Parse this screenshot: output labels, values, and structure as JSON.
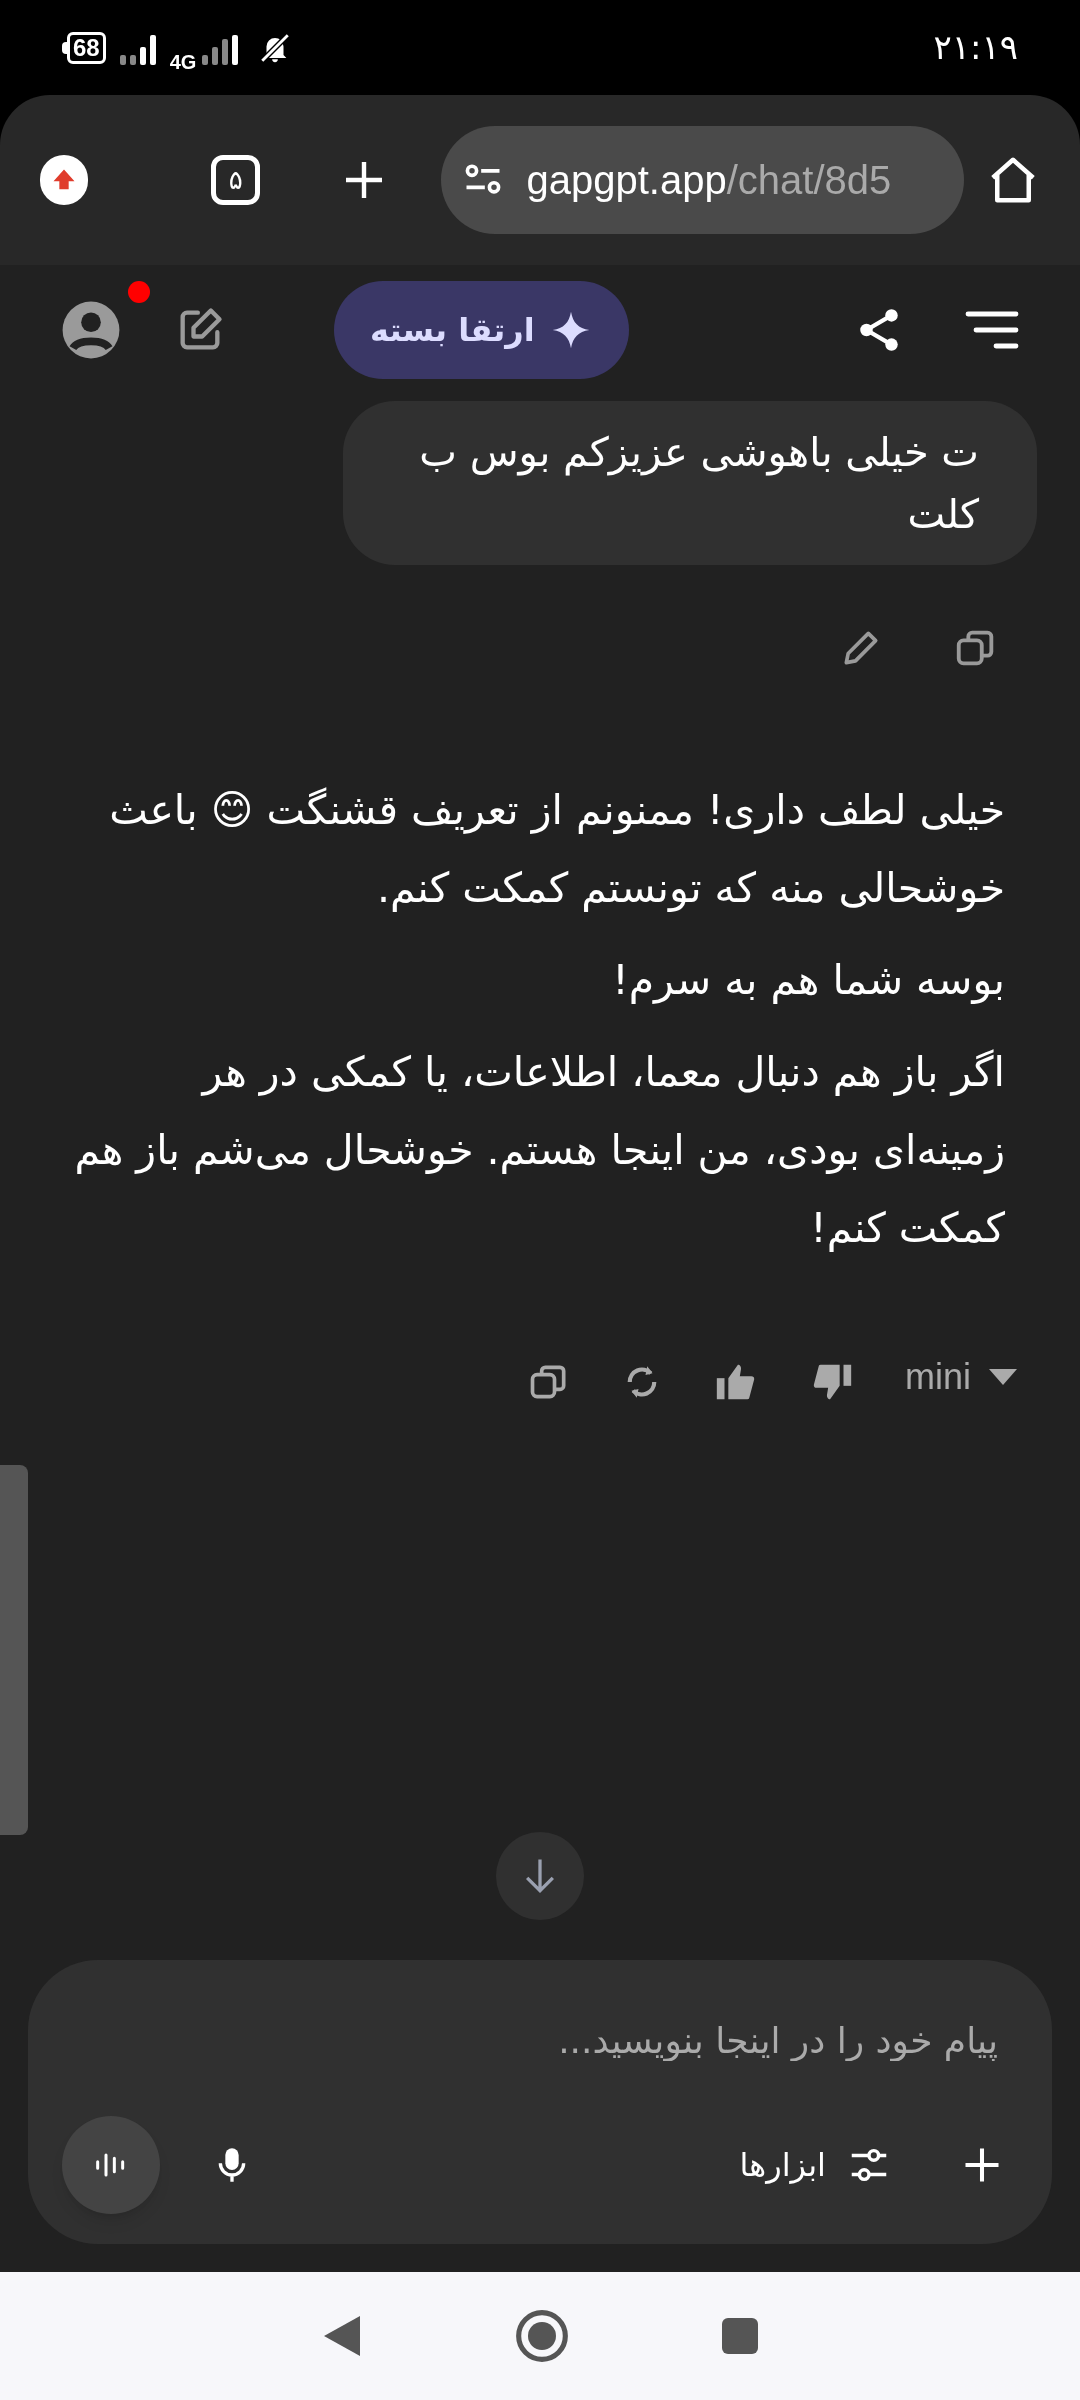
{
  "status_bar": {
    "battery": "68",
    "network": "4G",
    "time": "۲۱:۱۹"
  },
  "browser": {
    "tab_count": "۵",
    "url_host": "gapgpt.app",
    "url_path": "/chat/8d5"
  },
  "chat_header": {
    "upgrade_button": "ارتقا بسته",
    "has_notification": true
  },
  "messages": [
    {
      "kind": "user",
      "text": "ت خیلی باهوشی عزیزکم بوس ب کلت"
    },
    {
      "kind": "assistant",
      "paragraphs": [
        "خیلی لطف داری! ممنونم از تعریف قشنگت 😊 باعث خوشحالی منه که تونستم کمکت کنم.",
        "بوسه شما هم به سرم!",
        "اگر باز هم دنبال معما، اطلاعات، یا کمکی در هر زمینه‌ای بودی، من اینجا هستم. خوشحال می‌شم باز هم کمکت کنم!"
      ],
      "model": "mini"
    }
  ],
  "composer": {
    "placeholder": "پیام خود را در اینجا بنویسید...",
    "tools_button": "ابزارها"
  }
}
